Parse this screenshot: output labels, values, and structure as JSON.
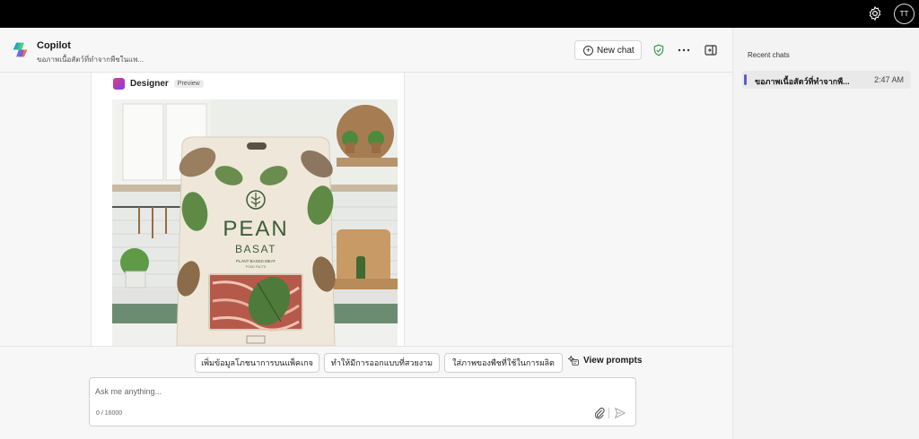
{
  "topbar": {
    "avatar_initials": "TT",
    "settings_icon": "gear-icon"
  },
  "header": {
    "app_title": "Copilot",
    "chat_subtitle": "ขอภาพเนื้อสัตว์ที่ทำจากพืชในแพ...",
    "new_chat_label": "New chat",
    "icons": [
      "copilot-logo-icon",
      "plus-circle-icon",
      "shield-check-icon",
      "more-icon",
      "sidebar-toggle-icon"
    ]
  },
  "card": {
    "designer_label": "Designer",
    "preview_tag": "Preview",
    "image": {
      "brand_line1": "PEAN",
      "brand_line2": "BASAT",
      "tagline": "PLANT BASED MEAT",
      "subtagline": "FOOD FACTS"
    }
  },
  "suggestions": [
    {
      "label": "เพิ่มข้อมูลโภชนาการบนแพ็คเกจ"
    },
    {
      "label": "ทำให้มีการออกแบบที่สวยงาม"
    },
    {
      "label": "ใส่ภาพของพืชที่ใช้ในการผลิต"
    }
  ],
  "view_prompts_label": "View prompts",
  "composer": {
    "placeholder": "Ask me anything...",
    "char_count": "0 / 16000"
  },
  "sidebar": {
    "recent_title": "Recent chats",
    "items": [
      {
        "title": "ขอภาพเนื้อสัตว์ที่ทำจากพื...",
        "time": "2:47 AM"
      }
    ]
  },
  "colors": {
    "accent": "#5b5fc7",
    "shield_green": "#2e9e48",
    "topbar": "#000000"
  }
}
